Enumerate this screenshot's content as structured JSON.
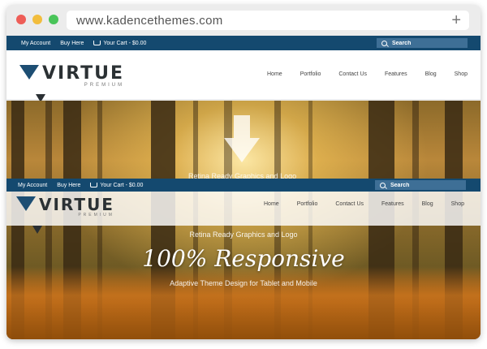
{
  "browser": {
    "url": "www.kadencethemes.com",
    "new_tab_label": "+"
  },
  "topbar": {
    "my_account": "My Account",
    "buy_here": "Buy Here",
    "cart": "Your Cart - $0.00",
    "search_placeholder": "Search"
  },
  "logo": {
    "name": "VIRTUE",
    "sub": "PREMIUM"
  },
  "nav": [
    "Home",
    "Portfolio",
    "Contact Us",
    "Features",
    "Blog",
    "Shop"
  ],
  "hero": {
    "retina_line": "Retina Ready Graphics and Logo",
    "title": "100% Responsive",
    "subtitle": "Adaptive Theme Design for Tablet and Mobile"
  },
  "colors": {
    "topbar": "#14496f",
    "logo_triangle": "#1d4e73",
    "search_bg": "#3e6f96"
  }
}
